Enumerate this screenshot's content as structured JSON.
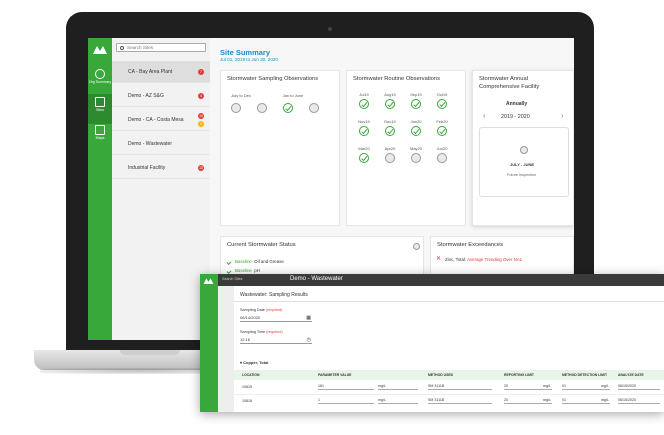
{
  "sidebar_nav": {
    "items": [
      {
        "label": "Org Summary"
      },
      {
        "label": "Sites"
      },
      {
        "label": "Maps"
      }
    ]
  },
  "sites": {
    "search_placeholder": "Search Sites",
    "items": [
      {
        "name": "CA - Bay Area Plant",
        "badges": [
          {
            "count": "7",
            "color": "red"
          }
        ]
      },
      {
        "name": "Demo - AZ S&G",
        "badges": [
          {
            "count": "4",
            "color": "red"
          }
        ]
      },
      {
        "name": "Demo - CA - Costa Mesa",
        "badges": [
          {
            "count": "10",
            "color": "red"
          },
          {
            "count": "2",
            "color": "yellow"
          }
        ]
      },
      {
        "name": "Demo - Wastewater",
        "badges": []
      },
      {
        "name": "Industrial Facility",
        "badges": [
          {
            "count": "13",
            "color": "red"
          }
        ]
      }
    ]
  },
  "summary": {
    "title": "Site Summary",
    "date_range": "Jul 01, 2019 to Jun 30, 2020"
  },
  "sampling_observations": {
    "title": "Stormwater Sampling Observations",
    "periods": [
      {
        "label": "July to Dec",
        "status": "empty"
      },
      {
        "label": "",
        "status": "empty"
      },
      {
        "label": "Jan to June",
        "status": "done"
      },
      {
        "label": "",
        "status": "empty"
      }
    ]
  },
  "routine_observations": {
    "title": "Stormwater Routine Observations",
    "months": [
      {
        "label": "Jul19",
        "status": "done"
      },
      {
        "label": "Aug19",
        "status": "done"
      },
      {
        "label": "Sep19",
        "status": "done"
      },
      {
        "label": "Oct19",
        "status": "done"
      },
      {
        "label": "Nov19",
        "status": "done"
      },
      {
        "label": "Dec19",
        "status": "done"
      },
      {
        "label": "Jan20",
        "status": "done"
      },
      {
        "label": "Feb20",
        "status": "done"
      },
      {
        "label": "Mar20",
        "status": "done"
      },
      {
        "label": "Apr20",
        "status": "empty"
      },
      {
        "label": "May20",
        "status": "empty"
      },
      {
        "label": "Jun20",
        "status": "empty"
      }
    ]
  },
  "annual": {
    "title_line1": "Stormwater Annual",
    "title_line2": "Comprehensive Facility",
    "sub": "Annually",
    "year": "2019 - 2020",
    "period": "JULY - JUNE",
    "note": "Future inspection"
  },
  "status": {
    "title": "Current Stormwater Status",
    "rows": [
      {
        "tag": "Baseline",
        "text": "Oil and Grease"
      },
      {
        "tag": "Baseline",
        "text": "pH"
      }
    ]
  },
  "exceedances": {
    "title": "Stormwater Exceedances",
    "rows": [
      {
        "param": "Zinc, Total:",
        "text": "Average Trending Over NAL"
      }
    ]
  },
  "overlay": {
    "search": "Search Sites",
    "site_title": "Demo - Wastewater",
    "panel_title": "Wastewater: Sampling Results",
    "date_label": "Sampling Date",
    "date_req": "(required)",
    "date_value": "06/14/2020",
    "time_label": "Sampling Time",
    "time_req": "(required)",
    "time_value": "12:16",
    "section": "Copper, Total",
    "columns": [
      "LOCATION",
      "PARAMETER VALUE",
      "METHOD USED",
      "REPORTING LIMIT",
      "METHOD DETECTION LIMIT",
      "ANALYZE DATE"
    ],
    "rows": [
      {
        "location": "10819",
        "value": "161",
        "unit": "mg/L",
        "method": "SM 3111B",
        "rl": "20",
        "rl_unit": "mg/L",
        "mdl": "01",
        "mdl_unit": "mg/L",
        "date": "06/15/2020"
      },
      {
        "location": "10818",
        "value": "1",
        "unit": "mg/L",
        "method": "SM 3111B",
        "rl": "20",
        "rl_unit": "mg/L",
        "mdl": "01",
        "mdl_unit": "mg/L",
        "date": "06/15/2020"
      }
    ]
  },
  "colors": {
    "brand_green": "#39a83a",
    "title_blue": "#1e88c9",
    "alert_red": "#e53935",
    "warn_yellow": "#f5b800"
  }
}
